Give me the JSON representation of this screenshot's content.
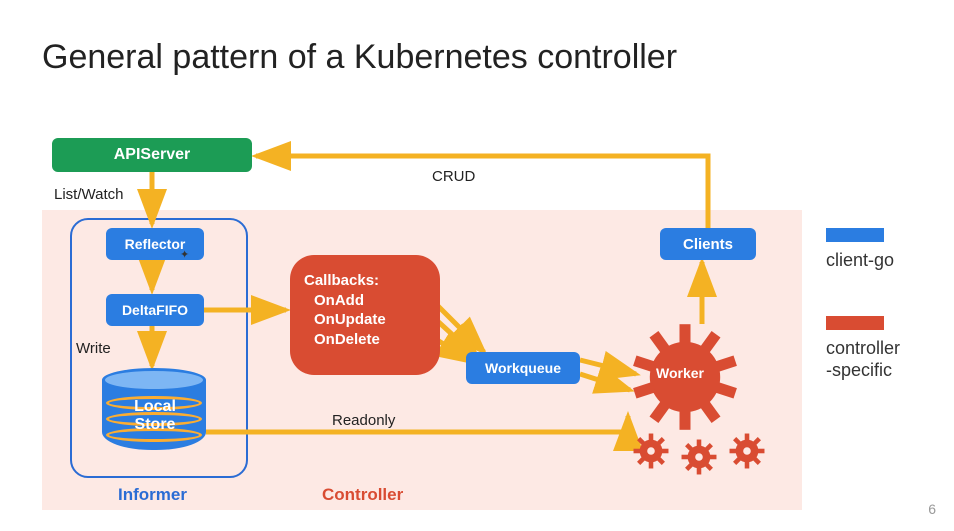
{
  "title": "General pattern of a Kubernetes controller",
  "nodes": {
    "apiserver": "APIServer",
    "reflector": "Reflector",
    "deltafifo": "DeltaFIFO",
    "localstore_l1": "Local",
    "localstore_l2": "Store",
    "workqueue": "Workqueue",
    "clients": "Clients",
    "worker": "Worker"
  },
  "callbacks": {
    "heading": "Callbacks:",
    "items": [
      "OnAdd",
      "OnUpdate",
      "OnDelete"
    ]
  },
  "edge_labels": {
    "listwatch": "List/Watch",
    "write": "Write",
    "readonly": "Readonly",
    "crud": "CRUD"
  },
  "group_labels": {
    "informer": "Informer",
    "controller": "Controller"
  },
  "legend": {
    "clientgo": "client-go",
    "controller_specific_l1": "controller",
    "controller_specific_l2": "-specific"
  },
  "colors": {
    "blue": "#2b7de1",
    "green": "#1c9c55",
    "red": "#d94c32",
    "arrow": "#f4b223",
    "informer_border": "#2b6cd4",
    "pink_bg": "#fde9e4"
  },
  "page_number": "6"
}
